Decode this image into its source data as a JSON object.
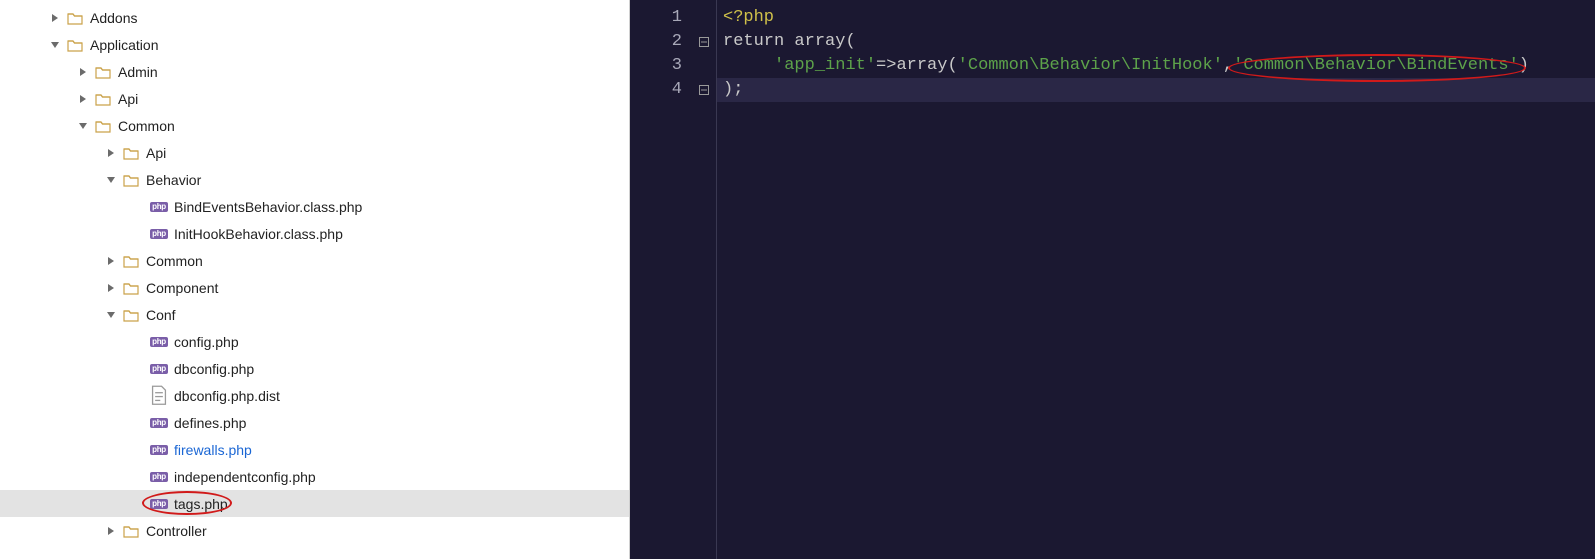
{
  "tree": {
    "items": [
      {
        "level": 1,
        "arrow": "closed",
        "kind": "folder",
        "label": "Addons"
      },
      {
        "level": 1,
        "arrow": "open",
        "kind": "folder",
        "label": "Application"
      },
      {
        "level": 2,
        "arrow": "closed",
        "kind": "folder",
        "label": "Admin"
      },
      {
        "level": 2,
        "arrow": "closed",
        "kind": "folder",
        "label": "Api"
      },
      {
        "level": 2,
        "arrow": "open",
        "kind": "folder",
        "label": "Common"
      },
      {
        "level": 3,
        "arrow": "closed",
        "kind": "folder",
        "label": "Api"
      },
      {
        "level": 3,
        "arrow": "open",
        "kind": "folder",
        "label": "Behavior"
      },
      {
        "level": 4,
        "arrow": "none",
        "kind": "php",
        "label": "BindEventsBehavior.class.php"
      },
      {
        "level": 4,
        "arrow": "none",
        "kind": "php",
        "label": "InitHookBehavior.class.php"
      },
      {
        "level": 3,
        "arrow": "closed",
        "kind": "folder",
        "label": "Common"
      },
      {
        "level": 3,
        "arrow": "closed",
        "kind": "folder",
        "label": "Component"
      },
      {
        "level": 3,
        "arrow": "open",
        "kind": "folder",
        "label": "Conf"
      },
      {
        "level": 4,
        "arrow": "none",
        "kind": "php",
        "label": "config.php"
      },
      {
        "level": 4,
        "arrow": "none",
        "kind": "php",
        "label": "dbconfig.php"
      },
      {
        "level": 4,
        "arrow": "none",
        "kind": "txt",
        "label": "dbconfig.php.dist"
      },
      {
        "level": 4,
        "arrow": "none",
        "kind": "php",
        "label": "defines.php"
      },
      {
        "level": 4,
        "arrow": "none",
        "kind": "php",
        "label": "firewalls.php",
        "link": true
      },
      {
        "level": 4,
        "arrow": "none",
        "kind": "php",
        "label": "independentconfig.php"
      },
      {
        "level": 4,
        "arrow": "none",
        "kind": "php",
        "label": "tags.php",
        "selected": true,
        "annot": true
      },
      {
        "level": 3,
        "arrow": "closed",
        "kind": "folder",
        "label": "Controller"
      }
    ]
  },
  "icons": {
    "php_badge": "php"
  },
  "editor": {
    "line_numbers": [
      "1",
      "2",
      "3",
      "4"
    ],
    "fold_markers": [
      "",
      "open",
      "",
      "close"
    ],
    "code": {
      "l1_open": "<?php",
      "l2_return": "return",
      "l2_array": "array",
      "l2_paren": "(",
      "l3_indent": "     ",
      "l3_key": "'app_init'",
      "l3_arrow": "=>",
      "l3_array": "array",
      "l3_open": "(",
      "l3_str1": "'Common\\Behavior\\InitHook'",
      "l3_comma": ",",
      "l3_str2": "'Common\\Behavior\\BindEvents'",
      "l3_close": ")",
      "l4_close": ");"
    },
    "annotation_circle": true
  },
  "colors": {
    "editor_bg": "#1b1831",
    "string": "#5da24a",
    "annotation": "#d11a1a"
  }
}
